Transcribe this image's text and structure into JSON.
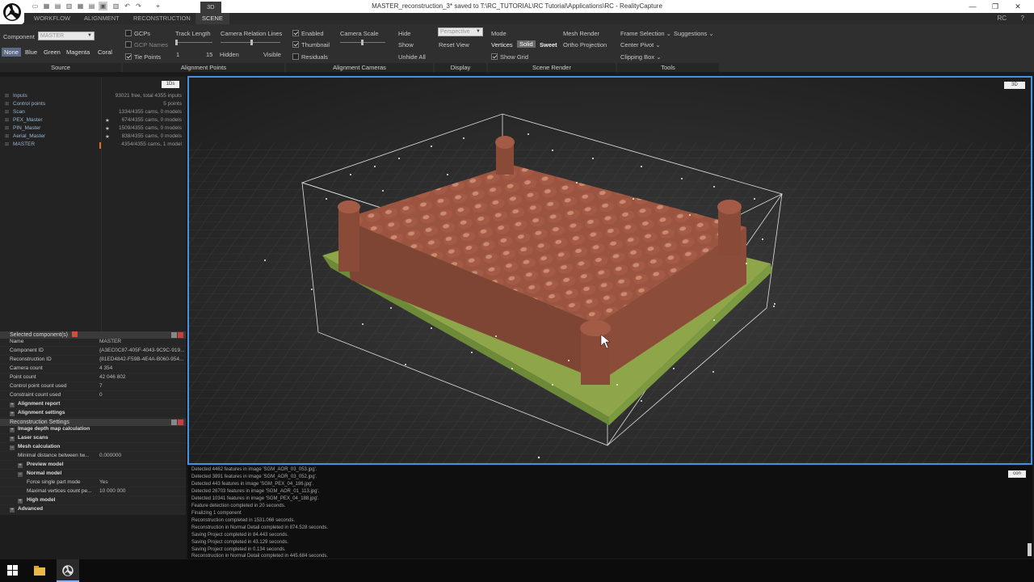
{
  "window": {
    "title": "MASTER_reconstruction_3* saved to T:\\RC_TUTORIAL\\RC Tutorial\\Applications\\RC - RealityCapture",
    "app_short": "RC"
  },
  "menu": {
    "tabs": [
      {
        "label": "WORKFLOW"
      },
      {
        "label": "ALIGNMENT"
      },
      {
        "label": "RECONSTRUCTION"
      },
      {
        "label": "SCENE"
      }
    ],
    "view_label": "3D"
  },
  "ribbon": {
    "source": {
      "component_label": "Component",
      "component_value": "MASTER",
      "colors": [
        "None",
        "Blue",
        "Green",
        "Magenta",
        "Coral"
      ],
      "section": "Source"
    },
    "alignment_points": {
      "gcps": "GCPs",
      "gcp_names": "GCP Names",
      "tie_points": "Tie Points",
      "track_length": "Track Length",
      "track_min": "1",
      "track_max": "15",
      "camera_relation_lines": "Camera Relation Lines",
      "hidden": "Hidden",
      "visible": "Visible",
      "section": "Alignment Points"
    },
    "alignment_cameras": {
      "enabled": "Enabled",
      "thumbnail": "Thumbnail",
      "residuals": "Residuals",
      "camera_scale": "Camera Scale",
      "hide": "Hide",
      "show": "Show",
      "unhide_all": "Unhide All",
      "section": "Alignment Cameras"
    },
    "display": {
      "projection": "Perspective",
      "reset_view": "Reset View",
      "section": "Display"
    },
    "scene_render": {
      "mode": "Mode",
      "mesh_render": "Mesh Render",
      "vertices": "Vertices",
      "solid": "Solid",
      "sweet": "Sweet",
      "ortho_projection": "Ortho Projection",
      "show_grid": "Show Grid",
      "section": "Scene Render"
    },
    "tools": {
      "frame_selection": "Frame Selection",
      "suggestions": "Suggestions",
      "center_pivot": "Center Pivot",
      "clipping_box": "Clipping Box",
      "section": "Tools"
    }
  },
  "tree": {
    "badge": "1Ds",
    "items": [
      {
        "name": "Inputs",
        "star": "",
        "info": "93021 free, total 4355 inputs"
      },
      {
        "name": "Control points",
        "star": "",
        "info": "5 points"
      },
      {
        "name": "Scan",
        "star": "",
        "info": "1334/4355 cams, 0 models"
      },
      {
        "name": "PEX_Master",
        "star": "★",
        "info": "674/4355 cams, 0 models"
      },
      {
        "name": "PIN_Master",
        "star": "★",
        "info": "1509/4355 cams, 0 models"
      },
      {
        "name": "Aerial_Master",
        "star": "★",
        "info": "838/4355 cams, 0 models"
      },
      {
        "name": "MASTER",
        "star": "",
        "info": "4354/4355 cams, 1 model"
      }
    ]
  },
  "selected": {
    "header": "Selected component(s)",
    "rows": [
      {
        "k": "Name",
        "v": "MASTER"
      },
      {
        "k": "Component ID",
        "v": "{A3EC0C87-405F-4043-9C9C-919..."
      },
      {
        "k": "Reconstruction ID",
        "v": "{81ED4842-F59B-4E4A-B060-954..."
      },
      {
        "k": "Camera count",
        "v": "4 354"
      },
      {
        "k": "Point count",
        "v": "42 046 802"
      },
      {
        "k": "Control point count used",
        "v": "7"
      },
      {
        "k": "Constraint count used",
        "v": "0"
      }
    ],
    "links": [
      "Alignment report",
      "Alignment settings"
    ]
  },
  "recon_settings": {
    "header": "Reconstruction Settings",
    "items": [
      {
        "label": "Image depth map calculation"
      },
      {
        "label": "Laser scans"
      },
      {
        "label": "Mesh calculation"
      }
    ],
    "min_dist_label": "Minimal distance between tw...",
    "min_dist_value": "0.000000",
    "preview_model": "Preview model",
    "normal_model": "Normal model",
    "force_single_label": "Force single part mode",
    "force_single_value": "Yes",
    "max_vertices_label": "Maximal vertices count pe...",
    "max_vertices_value": "10 000 000",
    "high_model": "High model",
    "advanced": "Advanced"
  },
  "viewport": {
    "badge": "3D"
  },
  "log": {
    "badge": "con",
    "lines": [
      "Detected 4462 features in image 'SGM_AOR_03_053.jpg'.",
      "Detected 3891 features in image 'SGM_AOR_03_052.jpg'.",
      "Detected 443 features in image 'SGM_PEX_04_186.jpg'.",
      "Detected 26703 features in image 'SGM_AOR_01_113.jpg'.",
      "Detected 10341 features in image 'SGM_PEX_04_188.jpg'.",
      "Feature detection completed in 20 seconds.",
      "Finalizing 1 component",
      "Reconstruction completed in 1531.066 seconds.",
      "Reconstruction in Normal Detail completed in 874.528 seconds.",
      "Saving Project completed in 84.443 seconds.",
      "Saving Project completed in 43.129 seconds.",
      "Saving Project completed in 0.134 seconds.",
      "Reconstruction in Normal Detail completed in 445.684 seconds."
    ]
  },
  "colors": {
    "accent": "#4a90e2",
    "selected_color_btn": "#5b6b85",
    "model_brick": "#a05a44",
    "model_grass": "#8fa84a"
  }
}
